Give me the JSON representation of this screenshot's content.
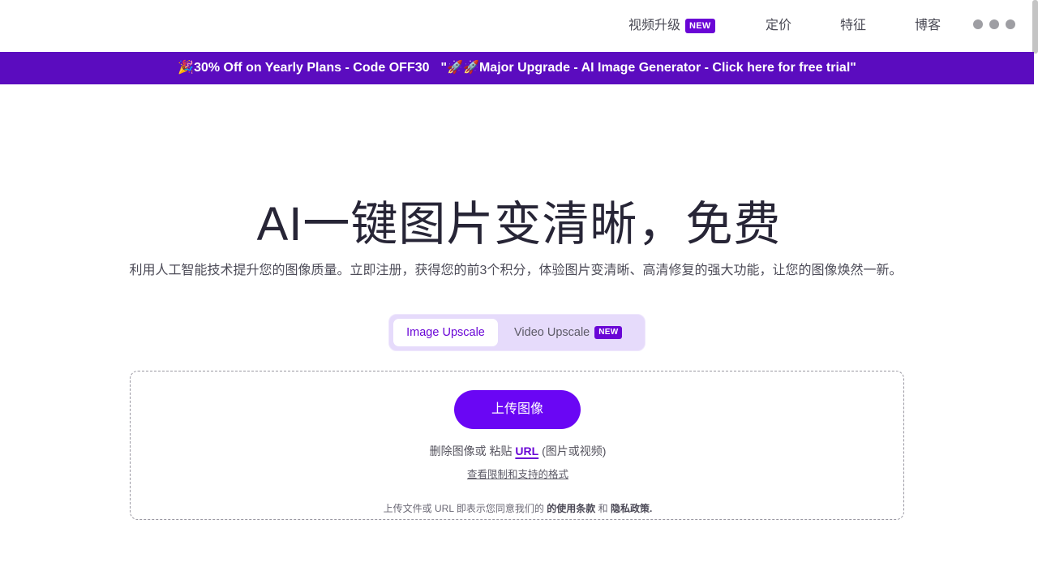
{
  "nav": {
    "items": [
      {
        "label": "视频升级",
        "badge": "NEW"
      },
      {
        "label": "定价"
      },
      {
        "label": "特征"
      },
      {
        "label": "博客"
      }
    ]
  },
  "promo": {
    "part1": "🎉30% Off on Yearly Plans - Code OFF30",
    "part2": "\"🚀🚀Major Upgrade - AI Image Generator - Click here for free trial\""
  },
  "hero": {
    "title": "AI一键图片变清晰，免费",
    "subtitle": "利用人工智能技术提升您的图像质量。立即注册，获得您的前3个积分，体验图片变清晰、高清修复的强大功能，让您的图像焕然一新。"
  },
  "tabs": {
    "image_upscale": "Image Upscale",
    "video_upscale": "Video Upscale",
    "video_badge": "NEW"
  },
  "upload": {
    "button_label": "上传图像",
    "drop_text": "删除图像或 粘贴",
    "url_link": "URL",
    "url_suffix": "(图片或视频)",
    "formats_link": "查看限制和支持的格式",
    "terms_prefix": "上传文件或 URL 即表示您同意我们的",
    "terms_link": "的使用条款",
    "terms_and": "和",
    "privacy_link": "隐私政策."
  },
  "colors": {
    "brand": "#6a06d6",
    "promo_bar": "#5b0cbf",
    "tab_bg": "#e6dbfb"
  }
}
